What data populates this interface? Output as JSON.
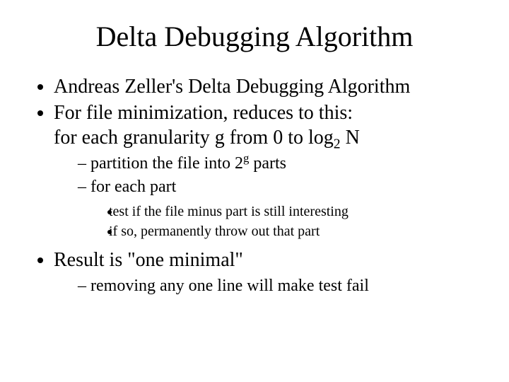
{
  "title": "Delta Debugging Algorithm",
  "b1": "Andreas Zeller's Delta Debugging Algorithm",
  "b2": "For file minimization, reduces to this:",
  "b2_line": "for each granularity g from 0 to log",
  "b2_sub": "2",
  "b2_tail": " N",
  "s1_pre": "partition the file into 2",
  "s1_sup": "g",
  "s1_post": " parts",
  "s2": "for each part",
  "t1": "test if the file minus part is still interesting",
  "t2": "if so, permanently throw out that part",
  "b3": "Result is \"one minimal\"",
  "s3": "removing any one line will make test fail"
}
